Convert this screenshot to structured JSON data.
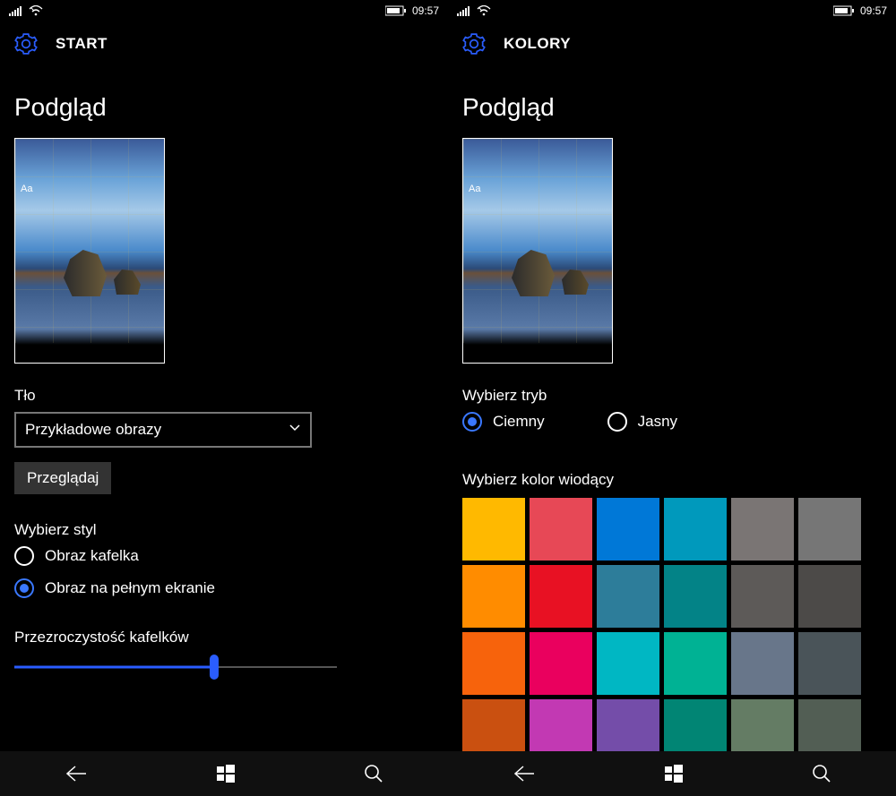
{
  "status": {
    "time": "09:57"
  },
  "left": {
    "header": "START",
    "preview_label": "Podgląd",
    "preview_aa": "Aa",
    "bg_label": "Tło",
    "bg_select_value": "Przykładowe obrazy",
    "browse_btn": "Przeglądaj",
    "style_label": "Wybierz styl",
    "style_options": {
      "tile": "Obraz kafelka",
      "full": "Obraz na pełnym ekranie"
    },
    "style_selected": "full",
    "opacity_label": "Przezroczystość kafelków",
    "opacity_value": 62
  },
  "right": {
    "header": "KOLORY",
    "preview_label": "Podgląd",
    "preview_aa": "Aa",
    "mode_label": "Wybierz tryb",
    "mode_options": {
      "dark": "Ciemny",
      "light": "Jasny"
    },
    "mode_selected": "dark",
    "accent_label": "Wybierz kolor wiodący",
    "accent_colors": [
      "#ffb900",
      "#e74856",
      "#0078d7",
      "#0099bc",
      "#7a7574",
      "#767676",
      "#ff8c00",
      "#e81123",
      "#2d7d9a",
      "#038387",
      "#5d5a58",
      "#4c4a48",
      "#f7630c",
      "#ea005e",
      "#00b7c3",
      "#00b294",
      "#68768a",
      "#4a5459",
      "#ca5010",
      "#c239b3",
      "#744da9",
      "#018574",
      "#647c64",
      "#525e54"
    ]
  }
}
